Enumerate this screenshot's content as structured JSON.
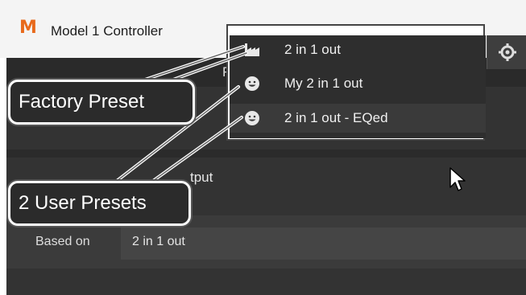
{
  "window": {
    "logo_text": "M",
    "title": "Model 1 Controller"
  },
  "app": {
    "partial_label_f": "F",
    "output_label_partial": "tput",
    "based_on_label": "Based on",
    "based_on_value": "2 in 1 out"
  },
  "dropdown": {
    "items": [
      {
        "label": "2 in 1 out",
        "icon": "factory-icon"
      },
      {
        "label": "My 2 in 1 out",
        "icon": "smiley-icon"
      },
      {
        "label": "2 in 1 out - EQed",
        "icon": "smiley-icon",
        "selected": true
      }
    ]
  },
  "callouts": {
    "factory_preset": "Factory Preset",
    "user_presets": "2 User Presets"
  },
  "colors": {
    "logo": "#e86a1c",
    "app_background": "#333333",
    "dropdown_background": "#2e2e2e"
  }
}
